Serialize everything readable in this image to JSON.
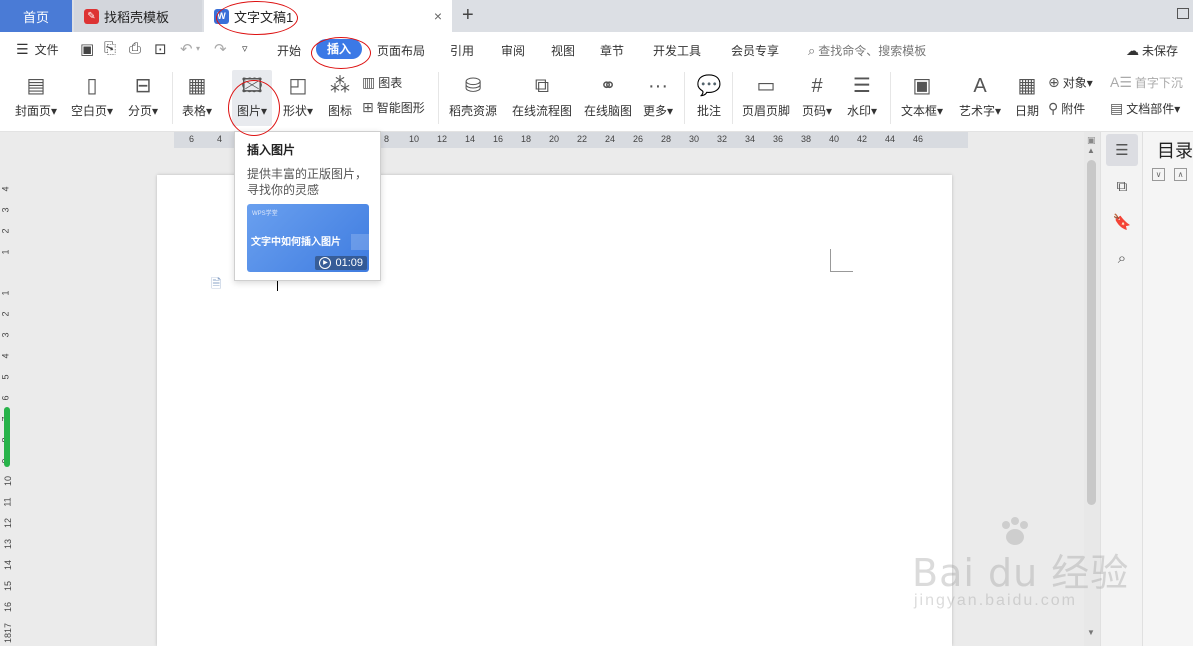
{
  "tabs": {
    "home": "首页",
    "templates": "找稻壳模板",
    "document": "文字文稿1",
    "add": "+",
    "close": "×"
  },
  "menu": {
    "file": "文件",
    "tabs": [
      "开始",
      "插入",
      "页面布局",
      "引用",
      "审阅",
      "视图",
      "章节",
      "开发工具",
      "会员专享"
    ],
    "active_tab": "插入",
    "search_placeholder": "查找命令、搜索模板",
    "unsaved": "未保存"
  },
  "ribbon": {
    "cover": "封面页",
    "blank": "空白页",
    "pagebreak": "分页",
    "table": "表格",
    "picture": "图片",
    "shape": "形状",
    "icon": "图标",
    "chart": "图表",
    "smartart": "智能图形",
    "resources": "稻壳资源",
    "flowchart": "在线流程图",
    "mindmap": "在线脑图",
    "more": "更多",
    "comment": "批注",
    "header_footer": "页眉页脚",
    "page_number": "页码",
    "watermark": "水印",
    "textbox": "文本框",
    "wordart": "艺术字",
    "date": "日期",
    "object": "对象",
    "dropcap": "首字下沉",
    "attachment": "附件",
    "doc_parts": "文档部件"
  },
  "tooltip": {
    "title": "插入图片",
    "description": "提供丰富的正版图片，寻找你的灵感",
    "video_title": "文字中如何插入图片",
    "video_watermark": "WPS学堂",
    "video_duration": "01:09"
  },
  "ruler": {
    "horizontal": [
      "6",
      "4",
      "8",
      "10",
      "12",
      "14",
      "16",
      "18",
      "20",
      "22",
      "24",
      "26",
      "28",
      "30",
      "32",
      "34",
      "36",
      "38",
      "40",
      "42",
      "44",
      "46"
    ],
    "vertical_top": [
      "4",
      "3",
      "2",
      "1"
    ],
    "vertical": [
      "1",
      "2",
      "3",
      "4",
      "5",
      "6",
      "7",
      "8",
      "9",
      "10",
      "11",
      "12",
      "13",
      "14",
      "15",
      "16",
      "17",
      "18"
    ]
  },
  "side_panel": {
    "toc_title": "目录"
  },
  "watermark": {
    "brand": "Bai du 经验",
    "url": "jingyan.baidu.com"
  },
  "colors": {
    "accent": "#3b79e6",
    "home_tab": "#4a7bd6",
    "annotation": "#d11111"
  }
}
